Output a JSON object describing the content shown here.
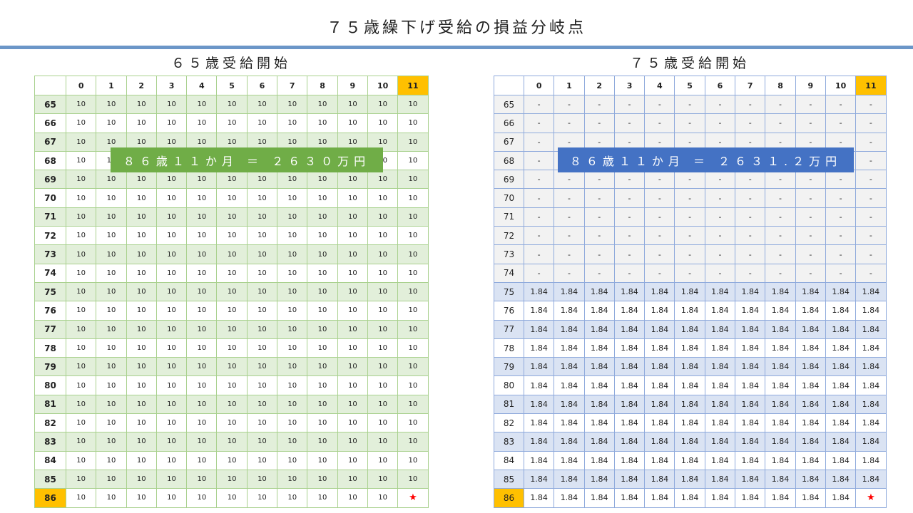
{
  "title": "７５歳繰下げ受給の損益分岐点",
  "colors": {
    "accent_bar": "#6b96c8",
    "left_theme": "#70ad47",
    "right_theme": "#4472c4",
    "highlight": "#ffc000",
    "star": "#ff0000"
  },
  "left": {
    "title": "６５歳受給開始",
    "banner": "８６歳１１か月 ＝ ２６３０万円",
    "columns": [
      "0",
      "1",
      "2",
      "3",
      "4",
      "5",
      "6",
      "7",
      "8",
      "9",
      "10",
      "11"
    ],
    "highlight_column": "11",
    "highlight_row": "86",
    "rows": [
      {
        "age": "65",
        "cells": [
          "10",
          "10",
          "10",
          "10",
          "10",
          "10",
          "10",
          "10",
          "10",
          "10",
          "10",
          "10"
        ]
      },
      {
        "age": "66",
        "cells": [
          "10",
          "10",
          "10",
          "10",
          "10",
          "10",
          "10",
          "10",
          "10",
          "10",
          "10",
          "10"
        ]
      },
      {
        "age": "67",
        "cells": [
          "10",
          "10",
          "10",
          "10",
          "10",
          "10",
          "10",
          "10",
          "10",
          "10",
          "10",
          "10"
        ]
      },
      {
        "age": "68",
        "cells": [
          "10",
          "10",
          "10",
          "10",
          "10",
          "10",
          "10",
          "10",
          "10",
          "10",
          "10",
          "10"
        ]
      },
      {
        "age": "69",
        "cells": [
          "10",
          "10",
          "10",
          "10",
          "10",
          "10",
          "10",
          "10",
          "10",
          "10",
          "10",
          "10"
        ]
      },
      {
        "age": "70",
        "cells": [
          "10",
          "10",
          "10",
          "10",
          "10",
          "10",
          "10",
          "10",
          "10",
          "10",
          "10",
          "10"
        ]
      },
      {
        "age": "71",
        "cells": [
          "10",
          "10",
          "10",
          "10",
          "10",
          "10",
          "10",
          "10",
          "10",
          "10",
          "10",
          "10"
        ]
      },
      {
        "age": "72",
        "cells": [
          "10",
          "10",
          "10",
          "10",
          "10",
          "10",
          "10",
          "10",
          "10",
          "10",
          "10",
          "10"
        ]
      },
      {
        "age": "73",
        "cells": [
          "10",
          "10",
          "10",
          "10",
          "10",
          "10",
          "10",
          "10",
          "10",
          "10",
          "10",
          "10"
        ]
      },
      {
        "age": "74",
        "cells": [
          "10",
          "10",
          "10",
          "10",
          "10",
          "10",
          "10",
          "10",
          "10",
          "10",
          "10",
          "10"
        ]
      },
      {
        "age": "75",
        "cells": [
          "10",
          "10",
          "10",
          "10",
          "10",
          "10",
          "10",
          "10",
          "10",
          "10",
          "10",
          "10"
        ]
      },
      {
        "age": "76",
        "cells": [
          "10",
          "10",
          "10",
          "10",
          "10",
          "10",
          "10",
          "10",
          "10",
          "10",
          "10",
          "10"
        ]
      },
      {
        "age": "77",
        "cells": [
          "10",
          "10",
          "10",
          "10",
          "10",
          "10",
          "10",
          "10",
          "10",
          "10",
          "10",
          "10"
        ]
      },
      {
        "age": "78",
        "cells": [
          "10",
          "10",
          "10",
          "10",
          "10",
          "10",
          "10",
          "10",
          "10",
          "10",
          "10",
          "10"
        ]
      },
      {
        "age": "79",
        "cells": [
          "10",
          "10",
          "10",
          "10",
          "10",
          "10",
          "10",
          "10",
          "10",
          "10",
          "10",
          "10"
        ]
      },
      {
        "age": "80",
        "cells": [
          "10",
          "10",
          "10",
          "10",
          "10",
          "10",
          "10",
          "10",
          "10",
          "10",
          "10",
          "10"
        ]
      },
      {
        "age": "81",
        "cells": [
          "10",
          "10",
          "10",
          "10",
          "10",
          "10",
          "10",
          "10",
          "10",
          "10",
          "10",
          "10"
        ]
      },
      {
        "age": "82",
        "cells": [
          "10",
          "10",
          "10",
          "10",
          "10",
          "10",
          "10",
          "10",
          "10",
          "10",
          "10",
          "10"
        ]
      },
      {
        "age": "83",
        "cells": [
          "10",
          "10",
          "10",
          "10",
          "10",
          "10",
          "10",
          "10",
          "10",
          "10",
          "10",
          "10"
        ]
      },
      {
        "age": "84",
        "cells": [
          "10",
          "10",
          "10",
          "10",
          "10",
          "10",
          "10",
          "10",
          "10",
          "10",
          "10",
          "10"
        ]
      },
      {
        "age": "85",
        "cells": [
          "10",
          "10",
          "10",
          "10",
          "10",
          "10",
          "10",
          "10",
          "10",
          "10",
          "10",
          "10"
        ]
      },
      {
        "age": "86",
        "cells": [
          "10",
          "10",
          "10",
          "10",
          "10",
          "10",
          "10",
          "10",
          "10",
          "10",
          "10",
          "★"
        ]
      }
    ]
  },
  "right": {
    "title": "７５歳受給開始",
    "banner": "８６歳１１か月 ＝ ２６３１.２万円",
    "columns": [
      "0",
      "1",
      "2",
      "3",
      "4",
      "5",
      "6",
      "7",
      "8",
      "9",
      "10",
      "11"
    ],
    "highlight_column": "11",
    "highlight_row": "86",
    "rows": [
      {
        "age": "65",
        "cells": [
          "-",
          "-",
          "-",
          "-",
          "-",
          "-",
          "-",
          "-",
          "-",
          "-",
          "-",
          "-"
        ]
      },
      {
        "age": "66",
        "cells": [
          "-",
          "-",
          "-",
          "-",
          "-",
          "-",
          "-",
          "-",
          "-",
          "-",
          "-",
          "-"
        ]
      },
      {
        "age": "67",
        "cells": [
          "-",
          "-",
          "-",
          "-",
          "-",
          "-",
          "-",
          "-",
          "-",
          "-",
          "-",
          "-"
        ]
      },
      {
        "age": "68",
        "cells": [
          "-",
          "-",
          "-",
          "-",
          "-",
          "-",
          "-",
          "-",
          "-",
          "-",
          "-",
          "-"
        ]
      },
      {
        "age": "69",
        "cells": [
          "-",
          "-",
          "-",
          "-",
          "-",
          "-",
          "-",
          "-",
          "-",
          "-",
          "-",
          "-"
        ]
      },
      {
        "age": "70",
        "cells": [
          "-",
          "-",
          "-",
          "-",
          "-",
          "-",
          "-",
          "-",
          "-",
          "-",
          "-",
          "-"
        ]
      },
      {
        "age": "71",
        "cells": [
          "-",
          "-",
          "-",
          "-",
          "-",
          "-",
          "-",
          "-",
          "-",
          "-",
          "-",
          "-"
        ]
      },
      {
        "age": "72",
        "cells": [
          "-",
          "-",
          "-",
          "-",
          "-",
          "-",
          "-",
          "-",
          "-",
          "-",
          "-",
          "-"
        ]
      },
      {
        "age": "73",
        "cells": [
          "-",
          "-",
          "-",
          "-",
          "-",
          "-",
          "-",
          "-",
          "-",
          "-",
          "-",
          "-"
        ]
      },
      {
        "age": "74",
        "cells": [
          "-",
          "-",
          "-",
          "-",
          "-",
          "-",
          "-",
          "-",
          "-",
          "-",
          "-",
          "-"
        ]
      },
      {
        "age": "75",
        "cells": [
          "1.84",
          "1.84",
          "1.84",
          "1.84",
          "1.84",
          "1.84",
          "1.84",
          "1.84",
          "1.84",
          "1.84",
          "1.84",
          "1.84"
        ]
      },
      {
        "age": "76",
        "cells": [
          "1.84",
          "1.84",
          "1.84",
          "1.84",
          "1.84",
          "1.84",
          "1.84",
          "1.84",
          "1.84",
          "1.84",
          "1.84",
          "1.84"
        ]
      },
      {
        "age": "77",
        "cells": [
          "1.84",
          "1.84",
          "1.84",
          "1.84",
          "1.84",
          "1.84",
          "1.84",
          "1.84",
          "1.84",
          "1.84",
          "1.84",
          "1.84"
        ]
      },
      {
        "age": "78",
        "cells": [
          "1.84",
          "1.84",
          "1.84",
          "1.84",
          "1.84",
          "1.84",
          "1.84",
          "1.84",
          "1.84",
          "1.84",
          "1.84",
          "1.84"
        ]
      },
      {
        "age": "79",
        "cells": [
          "1.84",
          "1.84",
          "1.84",
          "1.84",
          "1.84",
          "1.84",
          "1.84",
          "1.84",
          "1.84",
          "1.84",
          "1.84",
          "1.84"
        ]
      },
      {
        "age": "80",
        "cells": [
          "1.84",
          "1.84",
          "1.84",
          "1.84",
          "1.84",
          "1.84",
          "1.84",
          "1.84",
          "1.84",
          "1.84",
          "1.84",
          "1.84"
        ]
      },
      {
        "age": "81",
        "cells": [
          "1.84",
          "1.84",
          "1.84",
          "1.84",
          "1.84",
          "1.84",
          "1.84",
          "1.84",
          "1.84",
          "1.84",
          "1.84",
          "1.84"
        ]
      },
      {
        "age": "82",
        "cells": [
          "1.84",
          "1.84",
          "1.84",
          "1.84",
          "1.84",
          "1.84",
          "1.84",
          "1.84",
          "1.84",
          "1.84",
          "1.84",
          "1.84"
        ]
      },
      {
        "age": "83",
        "cells": [
          "1.84",
          "1.84",
          "1.84",
          "1.84",
          "1.84",
          "1.84",
          "1.84",
          "1.84",
          "1.84",
          "1.84",
          "1.84",
          "1.84"
        ]
      },
      {
        "age": "84",
        "cells": [
          "1.84",
          "1.84",
          "1.84",
          "1.84",
          "1.84",
          "1.84",
          "1.84",
          "1.84",
          "1.84",
          "1.84",
          "1.84",
          "1.84"
        ]
      },
      {
        "age": "85",
        "cells": [
          "1.84",
          "1.84",
          "1.84",
          "1.84",
          "1.84",
          "1.84",
          "1.84",
          "1.84",
          "1.84",
          "1.84",
          "1.84",
          "1.84"
        ]
      },
      {
        "age": "86",
        "cells": [
          "1.84",
          "1.84",
          "1.84",
          "1.84",
          "1.84",
          "1.84",
          "1.84",
          "1.84",
          "1.84",
          "1.84",
          "1.84",
          "★"
        ]
      }
    ]
  }
}
